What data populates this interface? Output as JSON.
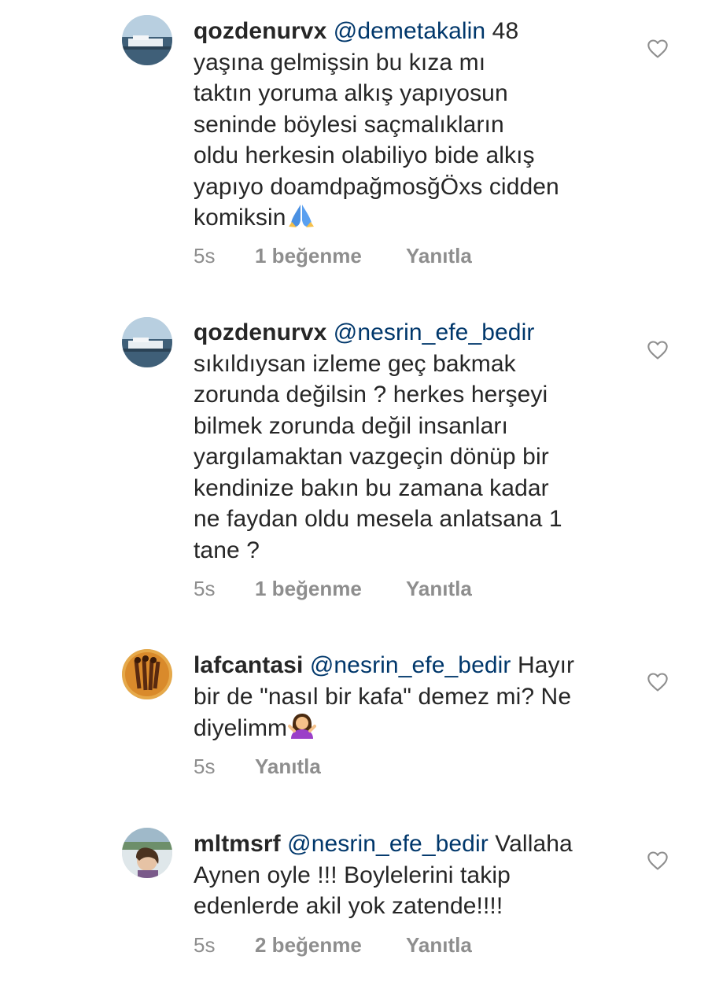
{
  "comments": [
    {
      "username": "qozdenurvx",
      "mention": "@demetakalin",
      "lines": [
        "48",
        "yaşına gelmişsin bu kıza mı",
        "taktın yoruma alkış yapıyosun",
        "seninde böylesi saçmalıkların",
        "oldu herkesin olabiliyo bide alkış",
        "yapıyo doamdpağmosğÖxs cidden",
        "komiksin"
      ],
      "emoji": "folded-hands",
      "time": "5s",
      "likes": "1 beğenme",
      "reply": "Yanıtla"
    },
    {
      "username": "qozdenurvx",
      "mention": "@nesrin_efe_bedir",
      "lines": [
        "sıkıldıysan izleme geç bakmak",
        "zorunda değilsin ? herkes herşeyi",
        "bilmek zorunda değil insanları",
        "yargılamaktan vazgeçin dönüp bir",
        "kendinize bakın bu zamana kadar",
        "ne faydan oldu mesela anlatsana 1",
        "tane ?"
      ],
      "time": "5s",
      "likes": "1 beğenme",
      "reply": "Yanıtla"
    },
    {
      "username": "lafcantasi",
      "mention": "@nesrin_efe_bedir",
      "lines": [
        "Hayır",
        "bir de \"nasıl bir kafa\" demez mi? Ne",
        "diyelimm"
      ],
      "emoji": "shrugging-person",
      "time": "5s",
      "reply": "Yanıtla"
    },
    {
      "username": "mltmsrf",
      "mention": "@nesrin_efe_bedir",
      "lines": [
        "Vallaha",
        "Aynen oyle !!! Boylelerini takip",
        "edenlerde akil yok zatende!!!!"
      ],
      "time": "5s",
      "likes": "2 beğenme",
      "reply": "Yanıtla"
    }
  ],
  "colors": {
    "text": "#262626",
    "mention": "#00376b",
    "meta": "#8e8e8e"
  },
  "icons": {
    "like": "heart-outline-icon"
  }
}
